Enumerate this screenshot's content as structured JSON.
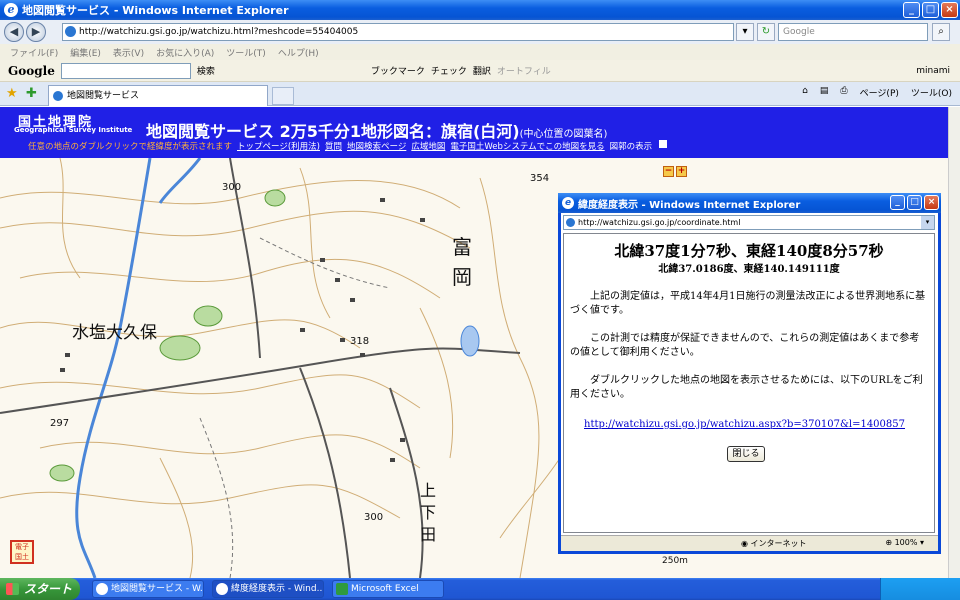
{
  "window": {
    "title": "地図閲覧サービス - Windows Internet Explorer"
  },
  "browser": {
    "address": "http://watchizu.gsi.go.jp/watchizu.html?meshcode=55404005",
    "search_placeholder": "Google",
    "menu": [
      "ファイル(F)",
      "編集(E)",
      "表示(V)",
      "お気に入り(A)",
      "ツール(T)",
      "ヘルプ(H)"
    ],
    "google_bar": {
      "logo": "Google",
      "search_btn": "検索",
      "bookmark": "ブックマーク",
      "check": "チェック",
      "translate": "翻訳",
      "autofill": "オートフィル",
      "user": "minami"
    },
    "tab_title": "地図閲覧サービス",
    "tools": {
      "page": "ページ(P)",
      "tool": "ツール(O)"
    }
  },
  "header": {
    "logo_jp": "国土地理院",
    "logo_en": "Geographical Survey Institute",
    "title": "地図閲覧サービス 2万5千分1地形図名：旗宿(白河)",
    "subtitle": "(中心位置の図葉名)",
    "hint": "任意の地点のダブルクリックで経緯度が表示されます",
    "links": [
      "トップページ(利用法)",
      "質問",
      "地図検索ページ",
      "広域地図",
      "電子国土Webシステムでこの地図を見る"
    ],
    "legend_label": "図郭の表示"
  },
  "map": {
    "labels": [
      "水塩大久保",
      "富岡",
      "上下田"
    ],
    "elevations": [
      "300",
      "354",
      "318",
      "297",
      "300"
    ],
    "scale": "250m",
    "stamp": "電子国土"
  },
  "popup": {
    "title": "緯度経度表示 - Windows Internet Explorer",
    "address": "http://watchizu.gsi.go.jp/coordinate.html",
    "coord_dms": "北緯37度1分7秒、東経140度8分57秒",
    "coord_dec": "北緯37.0186度、東経140.149111度",
    "para1": "上記の測定値は，平成14年4月1日施行の測量法改正による世界測地系に基づく値です。",
    "para2": "この計測では精度が保証できませんので、これらの測定値はあくまで参考の値として御利用ください。",
    "para3": "ダブルクリックした地点の地図を表示させるためには、以下のURLをご利用ください。",
    "url": "http://watchizu.gsi.go.jp/watchizu.aspx?b=370107&l=1400857",
    "close_label": "閉じる",
    "zone": "インターネット",
    "zoom": "100%"
  },
  "taskbar": {
    "start": "スタート",
    "items": [
      "地図閲覧サービス - W...",
      "緯度経度表示 - Wind...",
      "Microsoft Excel"
    ]
  }
}
